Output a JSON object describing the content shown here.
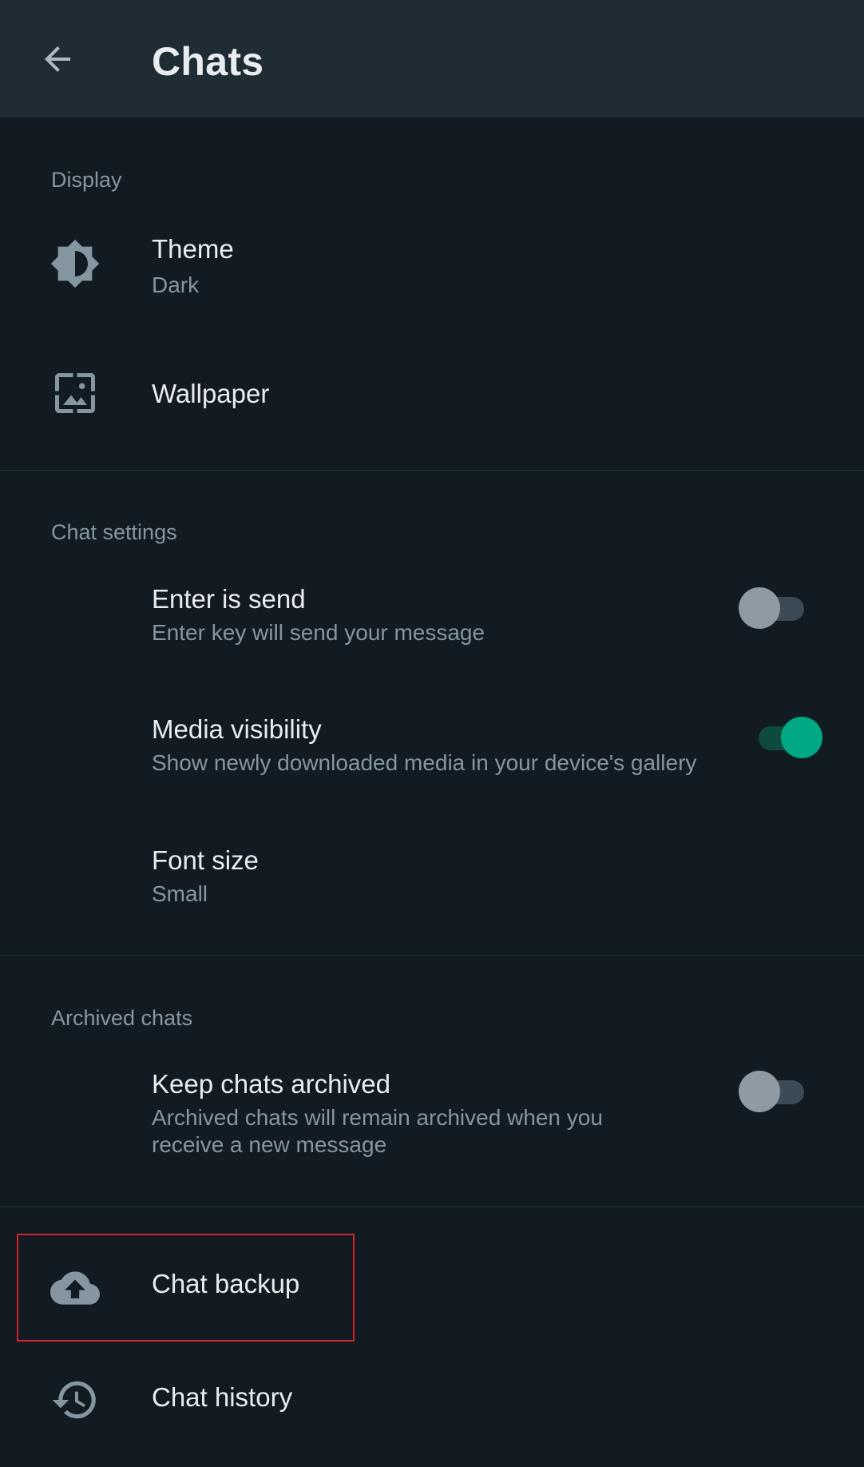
{
  "appbar": {
    "title": "Chats",
    "back_icon": "arrow-back-icon"
  },
  "sections": {
    "display": "Display",
    "chat_settings": "Chat settings",
    "archived": "Archived chats"
  },
  "items": {
    "theme": {
      "title": "Theme",
      "subtitle": "Dark",
      "icon": "brightness-icon"
    },
    "wallpaper": {
      "title": "Wallpaper",
      "icon": "wallpaper-icon"
    },
    "enter_send": {
      "title": "Enter is send",
      "subtitle": "Enter key will send your message",
      "checked": false
    },
    "media_visibility": {
      "title": "Media visibility",
      "subtitle": "Show newly downloaded media in your device's gallery",
      "checked": true
    },
    "font_size": {
      "title": "Font size",
      "subtitle": "Small"
    },
    "keep_archived": {
      "title": "Keep chats archived",
      "subtitle_line1": "Archived chats will remain archived when you",
      "subtitle_line2": "receive a new message",
      "checked": false
    },
    "chat_backup": {
      "title": "Chat backup",
      "icon": "cloud-upload-icon"
    },
    "chat_history": {
      "title": "Chat history",
      "icon": "history-icon"
    }
  },
  "colors": {
    "background": "#121b22",
    "appbar": "#1f2c34",
    "accent": "#00a884",
    "highlight": "#d2232a"
  }
}
